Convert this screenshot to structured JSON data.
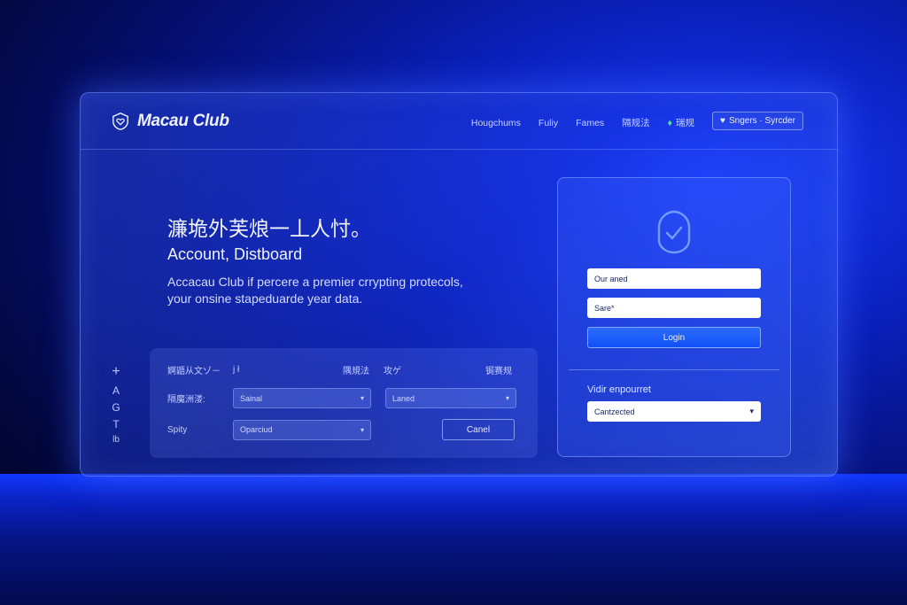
{
  "header": {
    "brand": "Macau Club",
    "nav": [
      "Hougchums",
      "Fuliy",
      "Fames",
      "隔规法"
    ],
    "nav_extra": "瑞规"
  },
  "signup_button": {
    "label": "Sngers · Syrcder"
  },
  "hero": {
    "cjk_title": "濂垝外芙烺一丄人忖。",
    "subtitle": "Account, Distboard",
    "description": "Accacau Club if percere a premier crrypting protecols, your onsine stapeduarde year data."
  },
  "side_icons": [
    "+",
    "A",
    "G",
    "T",
    "lb"
  ],
  "filter_form": {
    "row1": {
      "label": "婀鼯从文ゾ－",
      "col2": "j ł",
      "col3": "隅規法",
      "col4": "攻ゲ",
      "col5": "锔赛规"
    },
    "row2": {
      "label": "隔魔洲溇:",
      "dropdown1": "Sainal",
      "dropdown2": "Laned"
    },
    "row3": {
      "label": "Spity",
      "dropdown1": "Oparciud",
      "cancel": "Canel"
    }
  },
  "login": {
    "username_value": "Our aned",
    "password_value": "Sare*",
    "login_label": "Login",
    "section_label": "Vidir enpourret",
    "select_value": "Cantzected"
  },
  "colors": {
    "accent": "#1050f5",
    "background": "#061077"
  }
}
